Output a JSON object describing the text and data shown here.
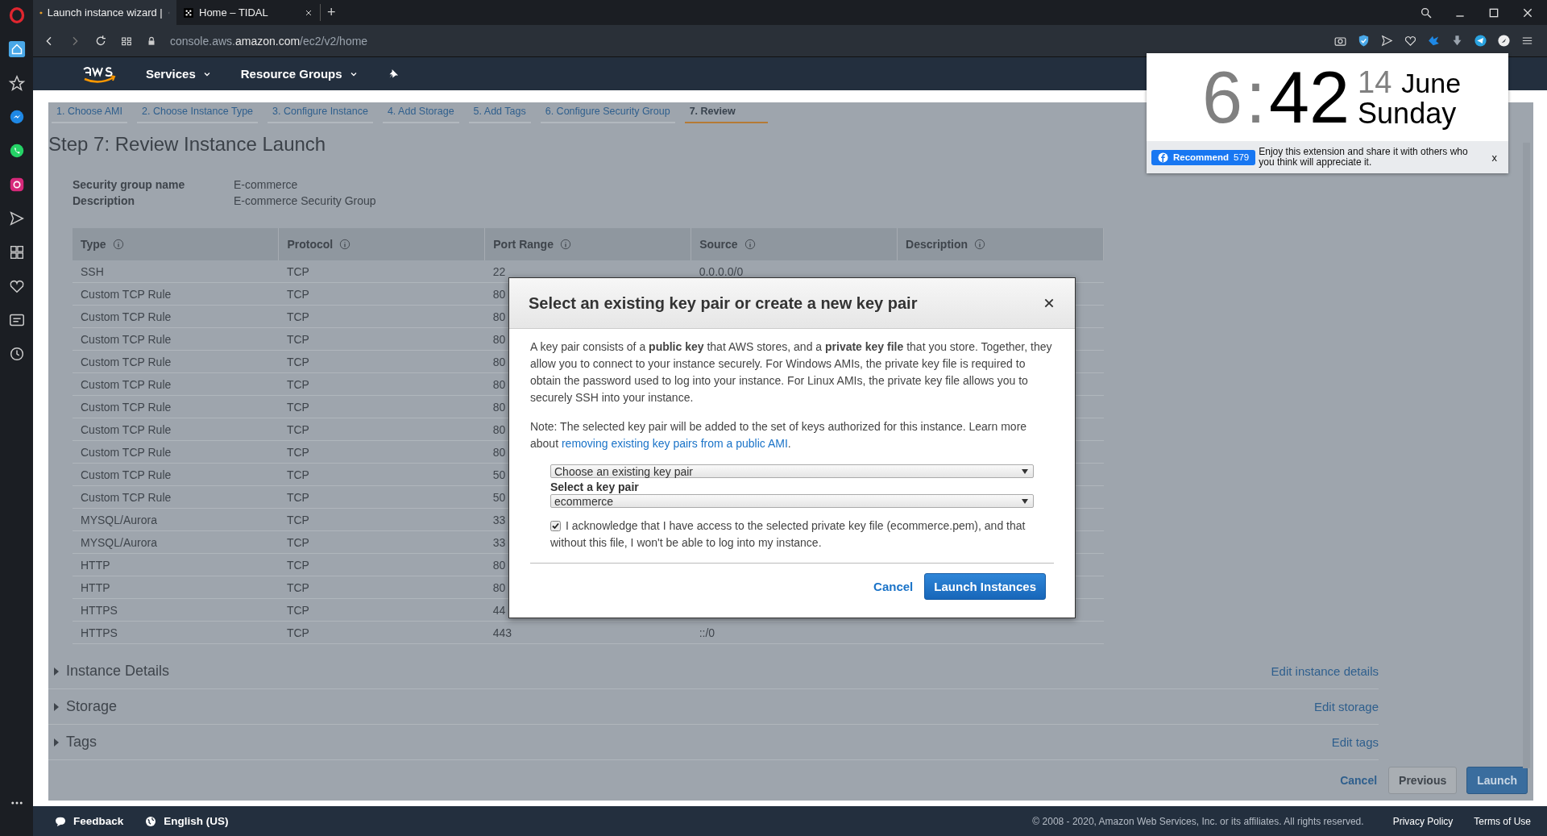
{
  "browser": {
    "tabs": [
      {
        "title": "Launch instance wizard |",
        "selected": true
      },
      {
        "title": "Home – TIDAL",
        "selected": false
      }
    ],
    "new_tab": "+",
    "address": {
      "prefix": "console.aws.",
      "host": "amazon.com",
      "path": "/ec2/v2/home"
    }
  },
  "aws_nav": {
    "items": [
      "Services",
      "Resource Groups"
    ]
  },
  "wizard_steps": [
    {
      "label": "1. Choose AMI",
      "selected": false
    },
    {
      "label": "2. Choose Instance Type",
      "selected": false
    },
    {
      "label": "3. Configure Instance",
      "selected": false
    },
    {
      "label": "4. Add Storage",
      "selected": false
    },
    {
      "label": "5. Add Tags",
      "selected": false
    },
    {
      "label": "6. Configure Security Group",
      "selected": false
    },
    {
      "label": "7. Review",
      "selected": true
    }
  ],
  "title": "Step 7: Review Instance Launch",
  "security_group": [
    {
      "label": "Security group name",
      "value": "E-commerce"
    },
    {
      "label": "Description",
      "value": "E-commerce Security Group"
    }
  ],
  "table": {
    "columns": [
      "Type",
      "Protocol",
      "Port Range",
      "Source",
      "Description"
    ],
    "rows": [
      [
        "SSH",
        "TCP",
        "22",
        "0.0.0.0/0"
      ],
      [
        "Custom TCP Rule",
        "TCP",
        "80"
      ],
      [
        "Custom TCP Rule",
        "TCP",
        "80"
      ],
      [
        "Custom TCP Rule",
        "TCP",
        "80"
      ],
      [
        "Custom TCP Rule",
        "TCP",
        "80"
      ],
      [
        "Custom TCP Rule",
        "TCP",
        "80"
      ],
      [
        "Custom TCP Rule",
        "TCP",
        "80"
      ],
      [
        "Custom TCP Rule",
        "TCP",
        "80"
      ],
      [
        "Custom TCP Rule",
        "TCP",
        "80"
      ],
      [
        "Custom TCP Rule",
        "TCP",
        "50"
      ],
      [
        "Custom TCP Rule",
        "TCP",
        "50"
      ],
      [
        "MYSQL/Aurora",
        "TCP",
        "33"
      ],
      [
        "MYSQL/Aurora",
        "TCP",
        "33"
      ],
      [
        "HTTP",
        "TCP",
        "80"
      ],
      [
        "HTTP",
        "TCP",
        "80"
      ],
      [
        "HTTPS",
        "TCP",
        "44"
      ],
      [
        "HTTPS",
        "TCP",
        "443",
        "::/0"
      ]
    ]
  },
  "sections": [
    {
      "title": "Instance Details",
      "link": "Edit instance details"
    },
    {
      "title": "Storage",
      "link": "Edit storage"
    },
    {
      "title": "Tags",
      "link": "Edit tags"
    }
  ],
  "wizard_buttons": {
    "cancel": "Cancel",
    "previous": "Previous",
    "launch": "Launch"
  },
  "footer": {
    "feedback": "Feedback",
    "language": "English (US)",
    "copyright": "© 2008 - 2020, Amazon Web Services, Inc. or its affiliates. All rights reserved.",
    "links": [
      "Privacy Policy",
      "Terms of Use"
    ]
  },
  "clock": {
    "hour": "6",
    "colon": ":",
    "minute": "42",
    "day": "14",
    "month": "June",
    "weekday": "Sunday",
    "recommend": "Recommend",
    "count": "579",
    "message": "Enjoy this extension and share it with others who you think will appreciate it.",
    "close": "x"
  },
  "modal": {
    "title": "Select an existing key pair or create a new key pair",
    "intro": "A key pair consists of a **public key** that AWS stores, and a **private key file** that you store. Together, they allow you to connect to your instance securely. For Windows AMIs, the private key file is required to obtain the password used to log into your instance. For Linux AMIs, the private key file allows you to securely SSH into your instance.",
    "note": "Note: The selected key pair will be added to the set of keys authorized for this instance. Learn more about",
    "note_link": "removing existing key pairs from a public AMI",
    "note_end": ".",
    "mode": "Choose an existing key pair",
    "select_label": "Select a key pair",
    "select_value": "ecommerce",
    "acknowledge": {
      "checked": true,
      "text": "I acknowledge that I have access to the selected private key file (ecommerce.pem), and that without this file, I won't be able to log into my instance."
    },
    "cancel": "Cancel",
    "launch": "Launch Instances"
  }
}
